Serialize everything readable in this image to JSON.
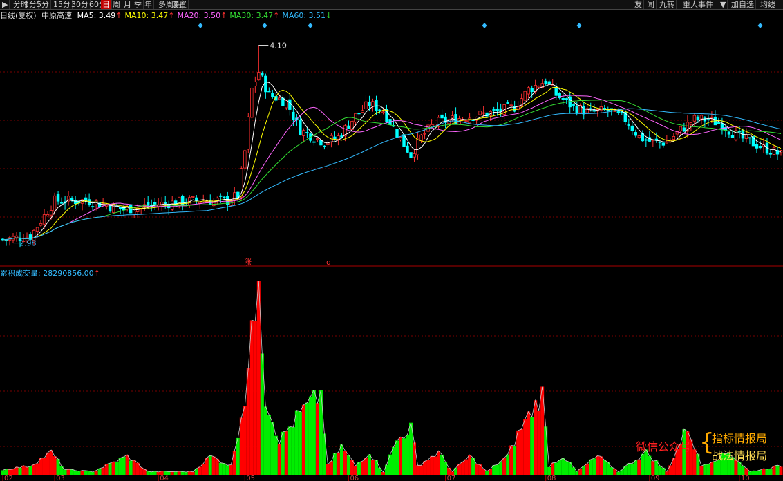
{
  "toolbar": {
    "left": [
      "分时",
      "1分",
      "5分",
      "15分",
      "30分",
      "60分",
      "日",
      "周",
      "月",
      "季",
      "年",
      "多周期",
      "设置"
    ],
    "active": "日",
    "right": [
      "友",
      "闻",
      "九转",
      "重大事件",
      "加自选",
      "均线"
    ]
  },
  "header": {
    "period": "日线(复权)",
    "stock": "中原高速",
    "ma": [
      {
        "label": "MA5: 3.49",
        "arrow": "↑",
        "color": "#ffffff"
      },
      {
        "label": "MA10: 3.47",
        "arrow": "↑",
        "color": "#ffff00"
      },
      {
        "label": "MA20: 3.50",
        "arrow": "↑",
        "color": "#ff66ff"
      },
      {
        "label": "MA30: 3.47",
        "arrow": "↑",
        "color": "#33dd33"
      },
      {
        "label": "MA60: 3.51",
        "arrow": "↓",
        "color": "#33bbff"
      }
    ]
  },
  "volume_header": {
    "label": "累积成交量: 28290856.00",
    "arrow": "↑",
    "color": "#33bbff"
  },
  "markers": {
    "zhang": "涨",
    "q": "q"
  },
  "annotations": {
    "high": "4.10",
    "low": "2.98"
  },
  "watermark": {
    "left": "微信公众号",
    "line1": "指标情报局",
    "line2": "战法情报局"
  },
  "colors": {
    "up": "#ff3030",
    "down": "#00ffff",
    "vol_up": "#ff0000",
    "vol_down": "#00ee00",
    "grid": "#7a0000",
    "bg": "#000000"
  },
  "chart_data": {
    "type": "candlestick",
    "y_range": [
      2.9,
      4.2
    ],
    "x_labels": [
      "02",
      "03",
      "04",
      "05",
      "06",
      "07",
      "08",
      "09",
      "10"
    ],
    "x_label_index": [
      0,
      15,
      45,
      70,
      100,
      128,
      157,
      187,
      213
    ],
    "n_bars": 226,
    "price_anchors": [
      [
        0,
        3.0
      ],
      [
        8,
        3.02
      ],
      [
        15,
        3.22
      ],
      [
        25,
        3.22
      ],
      [
        35,
        3.17
      ],
      [
        45,
        3.2
      ],
      [
        55,
        3.22
      ],
      [
        65,
        3.22
      ],
      [
        68,
        3.25
      ],
      [
        70,
        3.5
      ],
      [
        72,
        3.85
      ],
      [
        74,
        3.95
      ],
      [
        77,
        3.82
      ],
      [
        82,
        3.78
      ],
      [
        86,
        3.62
      ],
      [
        90,
        3.58
      ],
      [
        93,
        3.55
      ],
      [
        97,
        3.58
      ],
      [
        102,
        3.7
      ],
      [
        106,
        3.77
      ],
      [
        110,
        3.73
      ],
      [
        114,
        3.6
      ],
      [
        118,
        3.48
      ],
      [
        121,
        3.58
      ],
      [
        125,
        3.66
      ],
      [
        130,
        3.68
      ],
      [
        136,
        3.7
      ],
      [
        142,
        3.72
      ],
      [
        148,
        3.75
      ],
      [
        152,
        3.85
      ],
      [
        157,
        3.9
      ],
      [
        160,
        3.82
      ],
      [
        165,
        3.75
      ],
      [
        170,
        3.72
      ],
      [
        175,
        3.73
      ],
      [
        180,
        3.68
      ],
      [
        184,
        3.58
      ],
      [
        188,
        3.55
      ],
      [
        192,
        3.55
      ],
      [
        196,
        3.62
      ],
      [
        200,
        3.68
      ],
      [
        204,
        3.68
      ],
      [
        208,
        3.65
      ],
      [
        213,
        3.58
      ],
      [
        220,
        3.52
      ],
      [
        225,
        3.48
      ]
    ],
    "volume_anchors": [
      [
        0,
        0.03
      ],
      [
        8,
        0.05
      ],
      [
        14,
        0.12
      ],
      [
        18,
        0.03
      ],
      [
        26,
        0.02
      ],
      [
        36,
        0.1
      ],
      [
        42,
        0.02
      ],
      [
        55,
        0.02
      ],
      [
        60,
        0.1
      ],
      [
        66,
        0.05
      ],
      [
        70,
        0.4
      ],
      [
        74,
        1.0
      ],
      [
        76,
        0.4
      ],
      [
        80,
        0.18
      ],
      [
        86,
        0.32
      ],
      [
        92,
        0.42
      ],
      [
        94,
        0.05
      ],
      [
        98,
        0.15
      ],
      [
        102,
        0.05
      ],
      [
        106,
        0.12
      ],
      [
        110,
        0.02
      ],
      [
        114,
        0.18
      ],
      [
        118,
        0.25
      ],
      [
        120,
        0.05
      ],
      [
        126,
        0.12
      ],
      [
        130,
        0.02
      ],
      [
        135,
        0.1
      ],
      [
        140,
        0.02
      ],
      [
        146,
        0.1
      ],
      [
        150,
        0.25
      ],
      [
        156,
        0.42
      ],
      [
        158,
        0.05
      ],
      [
        162,
        0.1
      ],
      [
        166,
        0.02
      ],
      [
        172,
        0.1
      ],
      [
        178,
        0.02
      ],
      [
        186,
        0.12
      ],
      [
        192,
        0.02
      ],
      [
        198,
        0.25
      ],
      [
        202,
        0.05
      ],
      [
        210,
        0.12
      ],
      [
        216,
        0.02
      ],
      [
        225,
        0.05
      ]
    ],
    "volume_max": 28290856
  }
}
